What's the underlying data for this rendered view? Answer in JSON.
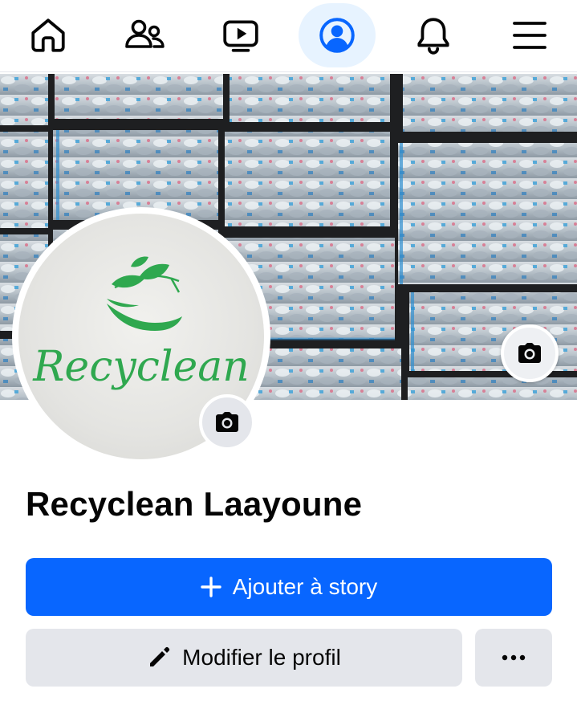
{
  "nav": {
    "items": [
      {
        "id": "home",
        "icon": "home-icon"
      },
      {
        "id": "friends",
        "icon": "friends-icon"
      },
      {
        "id": "video",
        "icon": "video-icon"
      },
      {
        "id": "profile",
        "icon": "profile-icon",
        "active": true
      },
      {
        "id": "notifications",
        "icon": "bell-icon"
      },
      {
        "id": "menu",
        "icon": "hamburger-menu-icon"
      }
    ],
    "active_color": "#0866ff"
  },
  "cover": {
    "description_icon": "camera-icon"
  },
  "avatar": {
    "logo_text": "Recyclean",
    "logo_color": "#2fa84f",
    "camera_icon": "camera-icon"
  },
  "profile": {
    "name": "Recyclean Laayoune"
  },
  "actions": {
    "add_story_label": "Ajouter à story",
    "edit_profile_label": "Modifier le profil",
    "more_icon": "more-dots-icon",
    "primary_color": "#0866ff"
  }
}
